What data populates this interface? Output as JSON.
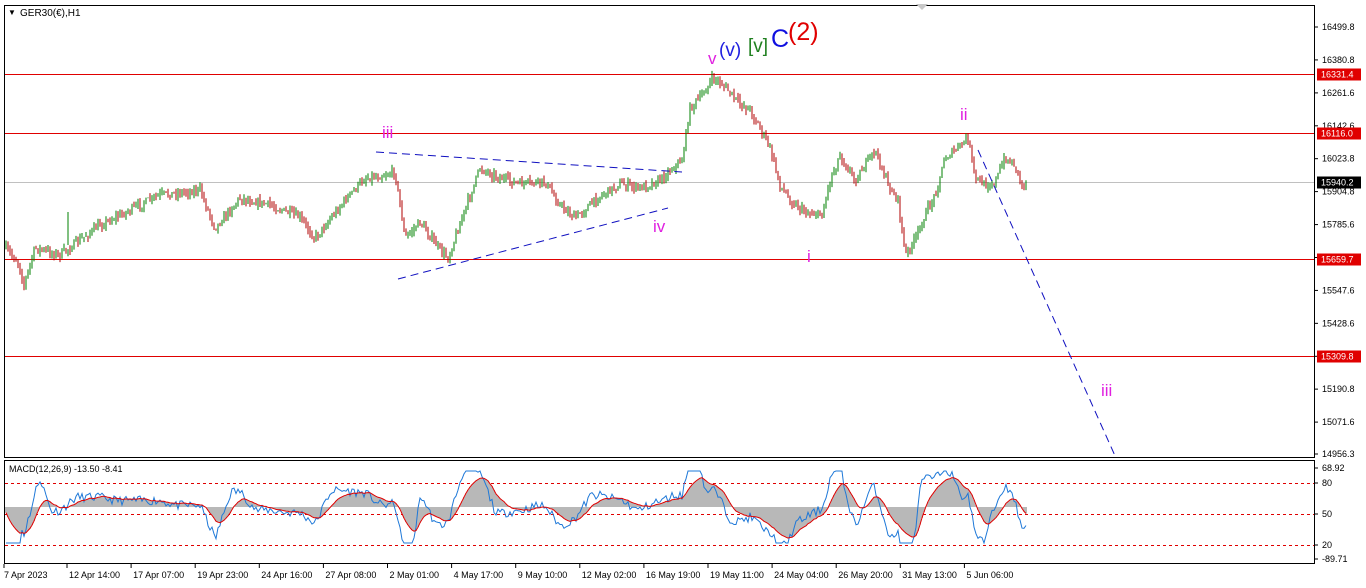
{
  "header": {
    "symbol": "GER30(€),H1",
    "triangle": "▼"
  },
  "price_axis": {
    "ticks": [
      "16499.8",
      "16380.8",
      "16261.6",
      "16142.6",
      "16023.8",
      "15904.8",
      "15785.6",
      "15666.6",
      "15547.6",
      "15428.6",
      "15309.4",
      "15190.8",
      "15071.6",
      "14956.3"
    ],
    "levels": [
      {
        "price": 16331.4,
        "label": "16331.4",
        "color": "#e00000"
      },
      {
        "price": 16116.0,
        "label": "16116.0",
        "color": "#e00000"
      },
      {
        "price": 15659.7,
        "label": "15659.7",
        "color": "#e00000"
      },
      {
        "price": 15309.8,
        "label": "15309.8",
        "color": "#e00000"
      }
    ],
    "current": {
      "price": 15940.2,
      "label": "15940.2"
    }
  },
  "wave_labels": [
    {
      "text": "iii",
      "color": "#e020e0"
    },
    {
      "text": "iv",
      "color": "#e020e0"
    },
    {
      "text": "v",
      "color": "#e020e0"
    },
    {
      "text": "(v)",
      "color": "#2020e0"
    },
    {
      "text": "[v]",
      "color": "#208020"
    },
    {
      "text": "C",
      "color": "#1010e0"
    },
    {
      "text": "(2)",
      "color": "#e00000"
    },
    {
      "text": "i",
      "color": "#e020e0"
    },
    {
      "text": "ii",
      "color": "#e020e0"
    },
    {
      "text": "iii",
      "color": "#e020e0"
    }
  ],
  "indicator": {
    "title": "MACD(12,26,9) -13.50 -8.41",
    "ticks": [
      "68.92",
      "80",
      "50",
      "20",
      "-89.71"
    ]
  },
  "time_axis": [
    "7 Apr 2023",
    "12 Apr 14:00",
    "17 Apr 07:00",
    "19 Apr 23:00",
    "24 Apr 16:00",
    "27 Apr 08:00",
    "2 May 01:00",
    "4 May 17:00",
    "9 May 10:00",
    "12 May 02:00",
    "16 May 19:00",
    "19 May 11:00",
    "24 May 04:00",
    "26 May 20:00",
    "31 May 13:00",
    "5 Jun 06:00"
  ],
  "colors": {
    "bull": "#008000",
    "bear": "#b00000",
    "level": "#e00000",
    "trend": "#1010c0",
    "macd_line": "#1e78d8",
    "signal_line": "#e00000",
    "hist": "#b8b8b8"
  },
  "chart_data": {
    "type": "line",
    "x": [
      "7 Apr 2023",
      "12 Apr 14:00",
      "17 Apr 07:00",
      "19 Apr 23:00",
      "24 Apr 16:00",
      "27 Apr 08:00",
      "2 May 01:00",
      "4 May 17:00",
      "9 May 10:00",
      "12 May 02:00",
      "16 May 19:00",
      "19 May 11:00",
      "24 May 04:00",
      "26 May 20:00",
      "31 May 13:00",
      "5 Jun 06:00"
    ],
    "series": [
      {
        "values": [
          15690,
          15760,
          15880,
          15840,
          15800,
          15960,
          15760,
          15980,
          15940,
          15950,
          16040,
          16320,
          15820,
          15990,
          15900,
          15960
        ]
      }
    ],
    "ylim": [
      14956.3,
      16499.8
    ]
  }
}
